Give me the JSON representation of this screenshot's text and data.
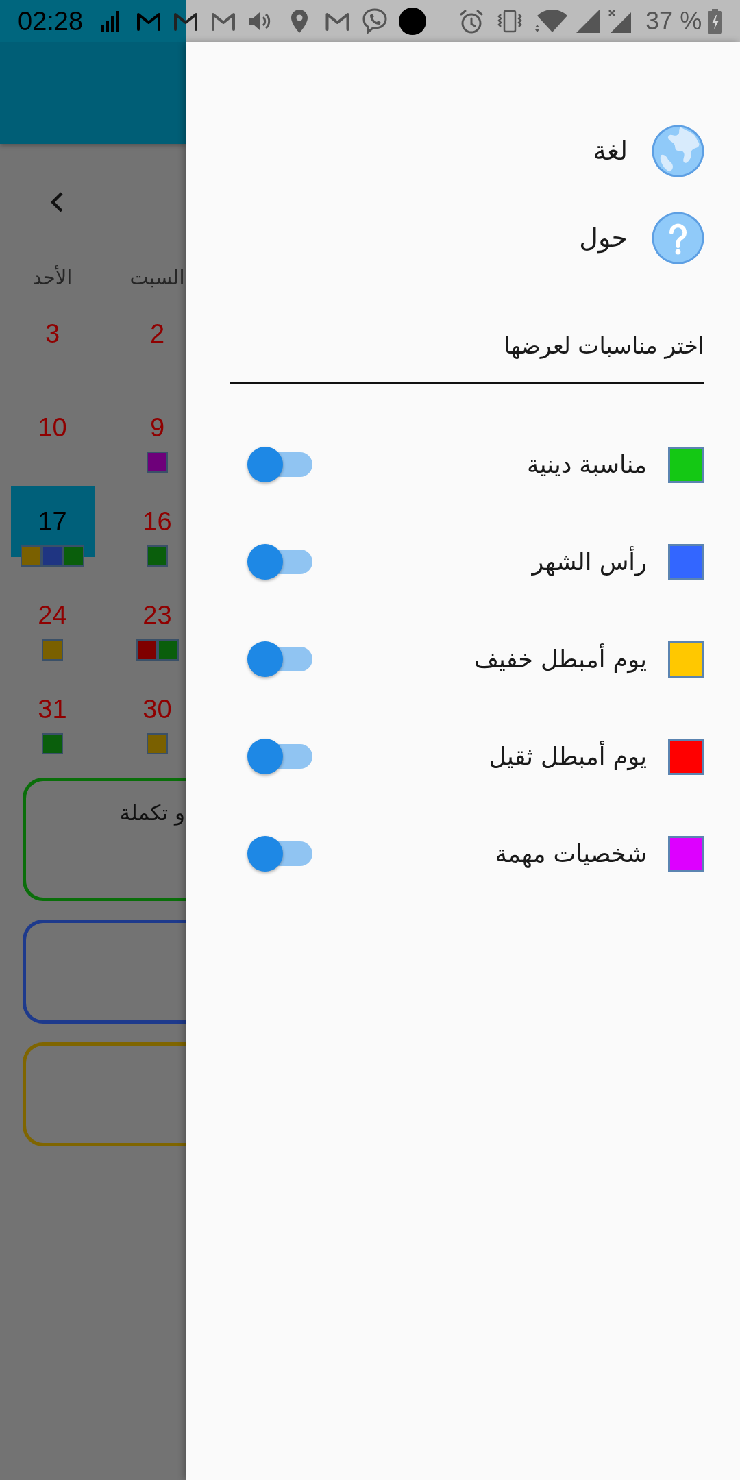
{
  "status_bar": {
    "time": "02:28",
    "battery": "37 %"
  },
  "calendar": {
    "weekdays": [
      "السبت",
      "الأحد"
    ],
    "weeks": [
      [
        {
          "day": "2",
          "selected": false
        },
        {
          "day": "3",
          "selected": false
        }
      ],
      [
        {
          "day": "9",
          "selected": false,
          "markers": [
            {
              "color": "#6e007a"
            }
          ]
        },
        {
          "day": "10",
          "selected": false
        }
      ],
      [
        {
          "day": "16",
          "selected": false,
          "markers": [
            {
              "color": "#0a5e0c"
            }
          ]
        },
        {
          "day": "17",
          "selected": true,
          "markers": [
            {
              "color": "#7a6000"
            },
            {
              "color": "#1f3582"
            },
            {
              "color": "#0a5e0c"
            }
          ]
        }
      ],
      [
        {
          "day": "23",
          "selected": false,
          "markers": [
            {
              "color": "#7f0000"
            },
            {
              "color": "#0a5e0c"
            }
          ]
        },
        {
          "day": "24",
          "selected": false,
          "markers": [
            {
              "color": "#7a6000"
            }
          ]
        }
      ],
      [
        {
          "day": "30",
          "selected": false,
          "markers": [
            {
              "color": "#7a6000"
            }
          ]
        },
        {
          "day": "31",
          "selected": false,
          "markers": [
            {
              "color": "#0a5e0c"
            }
          ]
        }
      ]
    ]
  },
  "event_cards": [
    {
      "color": "#0a6e0a",
      "text": "و تكملة"
    },
    {
      "color": "#1e3a8c"
    },
    {
      "color": "#7f6500"
    }
  ],
  "drawer": {
    "menu": [
      {
        "kind": "language",
        "label": "لغة"
      },
      {
        "kind": "about",
        "label": "حول"
      }
    ],
    "filter_title": "اختر مناسبات لعرضها",
    "categories": [
      {
        "label": "مناسبة دينية",
        "color": "#14c814",
        "on": true
      },
      {
        "label": "رأس الشهر",
        "color": "#3366ff",
        "on": true
      },
      {
        "label": "يوم أمبطل خفيف",
        "color": "#ffc800",
        "on": true
      },
      {
        "label": "يوم أمبطل ثقيل",
        "color": "#ff0000",
        "on": true
      },
      {
        "label": "شخصيات مهمة",
        "color": "#dd00ff",
        "on": true
      }
    ]
  }
}
